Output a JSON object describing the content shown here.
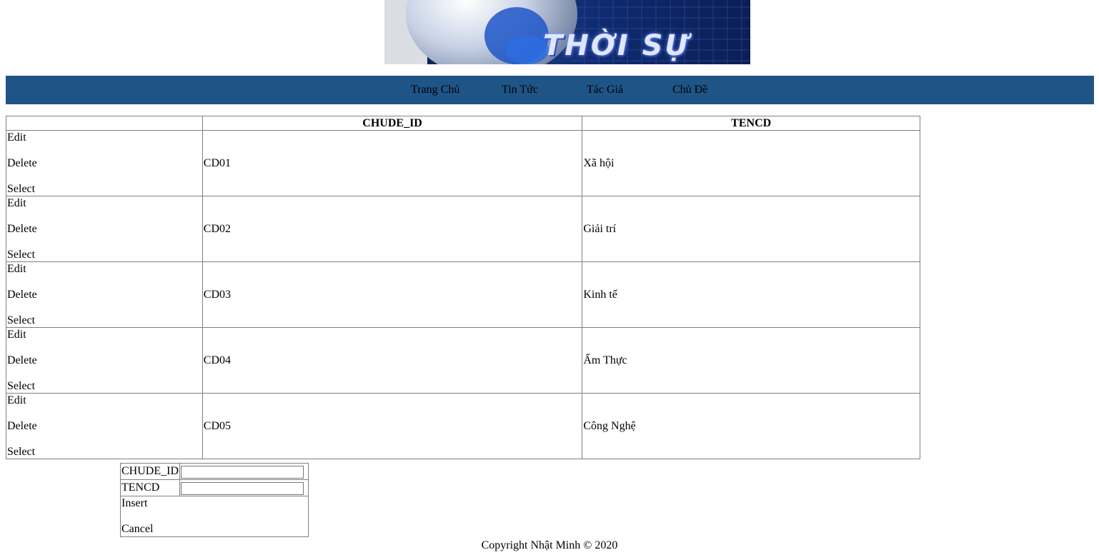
{
  "banner": {
    "title": "THỜI SỰ"
  },
  "nav": {
    "items": [
      "Trang Chủ",
      "Tin Tức",
      "Tác Giả",
      "Chủ Đề"
    ]
  },
  "grid": {
    "headers": [
      "",
      "CHUDE_ID",
      "TENCD"
    ],
    "commands": [
      "Edit",
      "Delete",
      "Select"
    ],
    "rows": [
      {
        "id": "CD01",
        "name": "Xã hội"
      },
      {
        "id": "CD02",
        "name": "Giải trí"
      },
      {
        "id": "CD03",
        "name": "Kinh tế"
      },
      {
        "id": "CD04",
        "name": "Ẩm Thực"
      },
      {
        "id": "CD05",
        "name": "Công Nghệ"
      }
    ]
  },
  "form": {
    "field1_label": "CHUDE_ID",
    "field1_value": "",
    "field2_label": "TENCD",
    "field2_value": "",
    "insert_label": "Insert",
    "cancel_label": "Cancel"
  },
  "footer": {
    "text": "Copyright Nhật Minh © 2020"
  }
}
